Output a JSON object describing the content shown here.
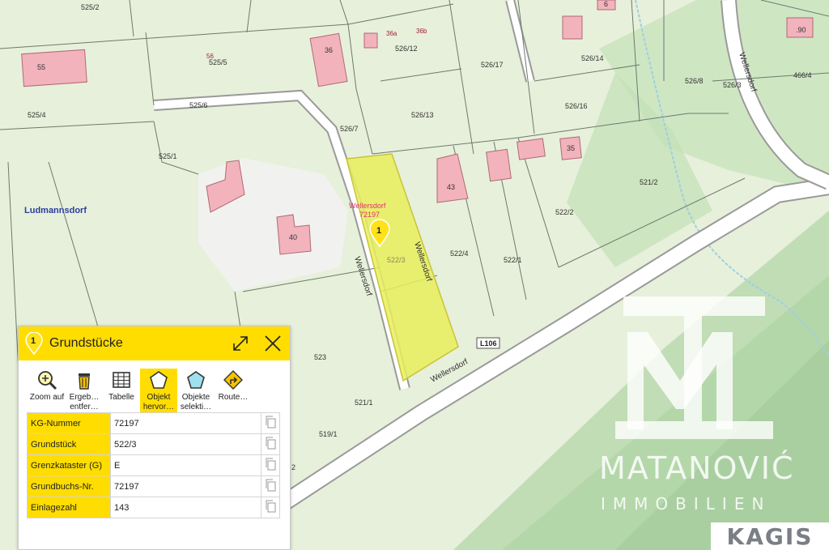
{
  "map": {
    "parcels": [
      "525/2",
      "526/12",
      "526/17",
      "526/14",
      "526/8",
      "526/3",
      "466/4",
      "525/5",
      "525/4",
      "525/6",
      "526/7",
      "526/13",
      "526/16",
      "525/1",
      "43",
      "522/2",
      "521/2",
      "522/3",
      "522/4",
      "522/1",
      "523",
      "521/1",
      "519/1",
      "2"
    ],
    "building_numbers": [
      "55",
      "56",
      "36",
      "36a",
      "36b",
      "6",
      ".90",
      "35",
      "40",
      "43"
    ],
    "place_label": "Ludmannsdorf",
    "street_labels": [
      "Wellersdorf",
      "Wellersdorf",
      "Wellersdorf",
      "Wellersdorf"
    ],
    "road_badge": "L106",
    "highlight": {
      "line1": "Wellersdorf",
      "line2": "72197",
      "marker": "1"
    }
  },
  "panel": {
    "marker": "1",
    "title": "Grundstücke",
    "tools": [
      {
        "label": "Zoom auf",
        "icon": "zoom-in-icon"
      },
      {
        "label": "Ergeb… entfer…",
        "icon": "trash-icon"
      },
      {
        "label": "Tabelle",
        "icon": "table-icon"
      },
      {
        "label": "Objekt hervor…",
        "icon": "pentagon-outline-icon"
      },
      {
        "label": "Objekte selekti…",
        "icon": "pentagon-filled-icon"
      },
      {
        "label": "Route…",
        "icon": "route-icon"
      }
    ],
    "rows": [
      {
        "key": "KG-Nummer",
        "value": "72197"
      },
      {
        "key": "Grundstück",
        "value": "522/3"
      },
      {
        "key": "Grenzkataster (G)",
        "value": "E"
      },
      {
        "key": "Grundbuchs-Nr.",
        "value": "72197"
      },
      {
        "key": "Einlagezahl",
        "value": "143"
      }
    ]
  },
  "watermark": {
    "name": "MATANOVIĆ",
    "sub": "IMMOBILIEN"
  },
  "badge": "KAGIS",
  "colors": {
    "accent": "#ffdd00",
    "highlight_fill": "#e8ef5a",
    "building": "#f2b3bc",
    "parcel_line": "#6d7a6d"
  }
}
